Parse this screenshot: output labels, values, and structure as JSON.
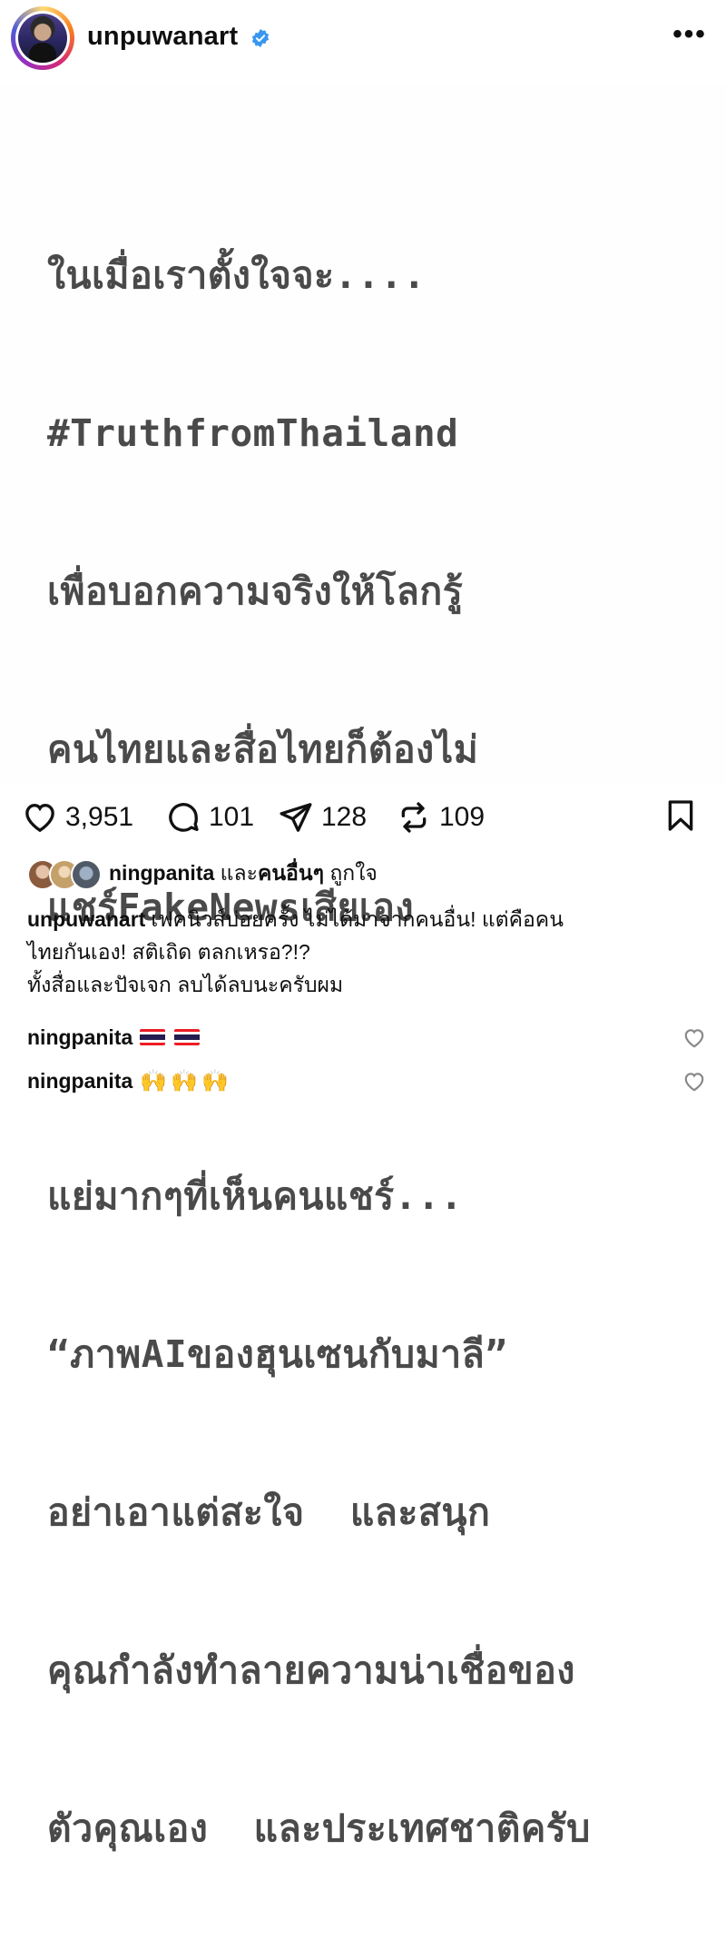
{
  "header": {
    "username": "unpuwanart",
    "verified_color": "#3897f0",
    "more_label": "•••"
  },
  "post": {
    "lines": [
      "ในเมื่อเราตั้งใจจะ....",
      "#TruthfromThailand",
      "เพื่อบอกความจริงให้โลกรู้",
      "คนไทยและสื่อไทยก็ต้องไม่",
      "แชร์FakeNewsเสียเอง",
      "",
      "แย่มากๆที่เห็นคนแชร์...",
      "“ภาพAIของฮุนเซนกับมาลี”",
      "อย่าเอาแต่สะใจ  และสนุก",
      "คุณกำลังทำลายความน่าเชื่อของ",
      "ตัวคุณเอง  และประเทศชาติครับ"
    ],
    "text_color": "#4a4a4a"
  },
  "actions": {
    "likes": "3,951",
    "comments": "101",
    "shares": "128",
    "reposts": "109"
  },
  "liked_by": {
    "user": "ningpanita",
    "and": "และ",
    "others": "คนอื่นๆ",
    "suffix": "ถูกใจ"
  },
  "caption": {
    "user": "unpuwanart",
    "line1": "เฟคนิวส์บ่อยครั้ง ไม่ได้มาจากคนอื่น! แต่คือคน",
    "line2": "ไทยกันเอง!  สติเถิด  ตลกเหรอ?!?",
    "line3": "ทั้งสื่อและปัจเจก ลบได้ลบนะครับผม"
  },
  "comments": [
    {
      "user": "ningpanita",
      "emoji_icons": [
        "thailand-flag-icon",
        "thailand-flag-icon"
      ]
    },
    {
      "user": "ningpanita",
      "emoji_icons": [
        "raising-hands-icon",
        "raising-hands-icon",
        "raising-hands-icon"
      ]
    }
  ],
  "hands_glyph": "🙌"
}
